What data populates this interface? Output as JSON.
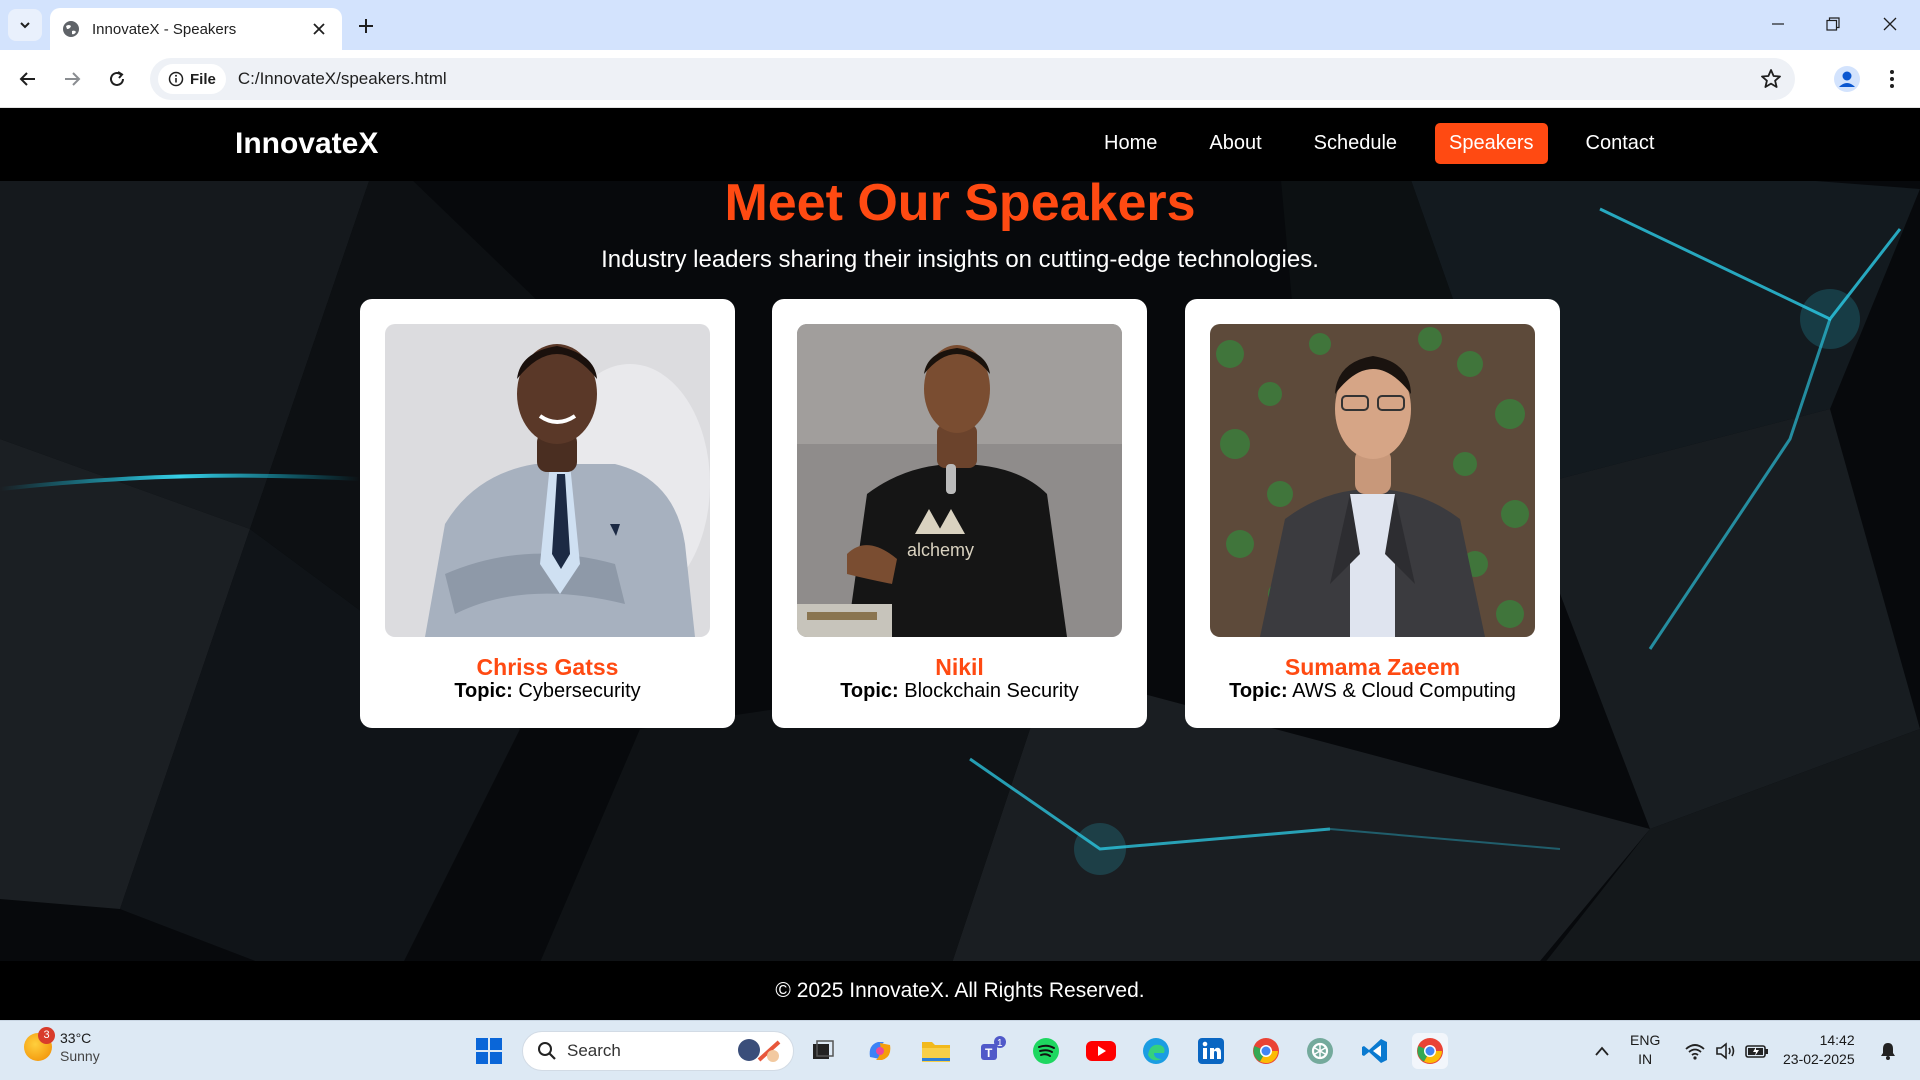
{
  "browser": {
    "tab_title": "InnovateX - Speakers",
    "file_chip": "File",
    "url": "C:/InnovateX/speakers.html"
  },
  "site": {
    "logo": "InnovateX",
    "nav": [
      "Home",
      "About",
      "Schedule",
      "Speakers",
      "Contact"
    ],
    "active_nav": "Speakers",
    "accent_color": "#ff4a12",
    "title": "Meet Our Speakers",
    "subtitle": "Industry leaders sharing their insights on cutting-edge technologies.",
    "topic_label": "Topic:",
    "speakers": [
      {
        "name": "Chriss Gatss",
        "topic": "Cybersecurity",
        "photo_shirt_text": ""
      },
      {
        "name": "Nikil",
        "topic": "Blockchain Security",
        "photo_shirt_text": "alchemy"
      },
      {
        "name": "Sumama Zaeem",
        "topic": "AWS & Cloud Computing",
        "photo_shirt_text": ""
      }
    ],
    "footer": "© 2025 InnovateX. All Rights Reserved."
  },
  "taskbar": {
    "weather_temp": "33°C",
    "weather_cond": "Sunny",
    "weather_badge": "3",
    "search_placeholder": "Search",
    "teams_badge": "1",
    "lang_1": "ENG",
    "lang_2": "IN",
    "time": "14:42",
    "date": "23-02-2025"
  }
}
